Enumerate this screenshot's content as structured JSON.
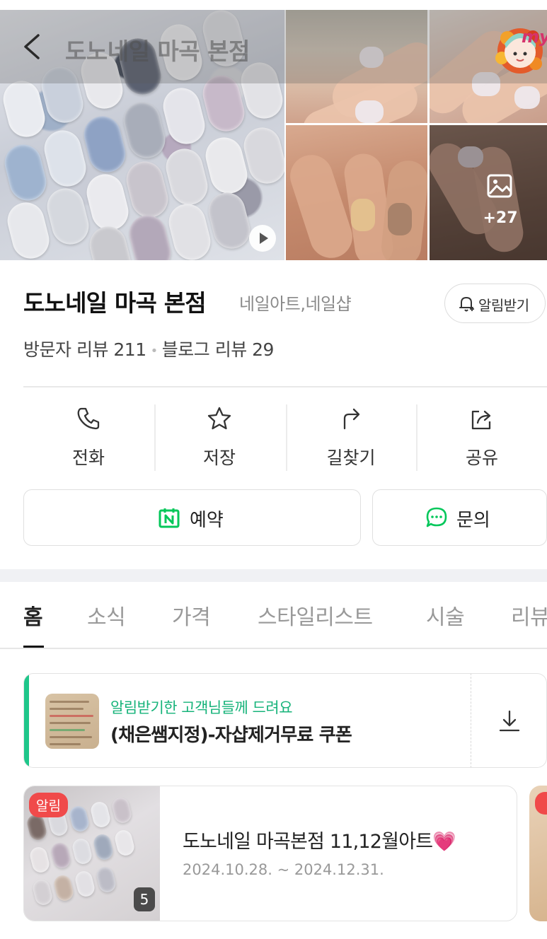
{
  "header": {
    "title": "도노네일 마곡 본점",
    "badge_text": "my"
  },
  "gallery": {
    "more_count": "+27"
  },
  "place": {
    "name": "도노네일 마곡 본점",
    "category": "네일아트,네일샵",
    "notify_label": "알림받기",
    "visitor_reviews": "방문자 리뷰 211",
    "blog_reviews": "블로그 리뷰 29"
  },
  "actions": [
    {
      "label": "전화",
      "icon": "phone-icon"
    },
    {
      "label": "저장",
      "icon": "star-icon"
    },
    {
      "label": "길찾기",
      "icon": "directions-icon"
    },
    {
      "label": "공유",
      "icon": "share-icon"
    }
  ],
  "buttons": {
    "reserve_label": "예약",
    "inquiry_label": "문의"
  },
  "tabs": [
    {
      "label": "홈",
      "active": true
    },
    {
      "label": "소식",
      "active": false
    },
    {
      "label": "가격",
      "active": false
    },
    {
      "label": "스타일리스트",
      "active": false
    },
    {
      "label": "시술",
      "active": false
    },
    {
      "label": "리뷰",
      "active": false
    }
  ],
  "coupon": {
    "subtitle": "알림받기한 고객님들께 드려요",
    "title": "(채은쌤지정)-자샵제거무료 쿠폰"
  },
  "notice": {
    "badge": "알림",
    "image_count": "5",
    "title": "도노네일 마곡본점 11,12월아트",
    "title_emoji": "💗",
    "date_range": "2024.10.28. ~ 2024.12.31."
  },
  "colors": {
    "accent_green": "#1ec68a",
    "badge_red": "#f04a4a",
    "naver_green": "#03c75a"
  }
}
